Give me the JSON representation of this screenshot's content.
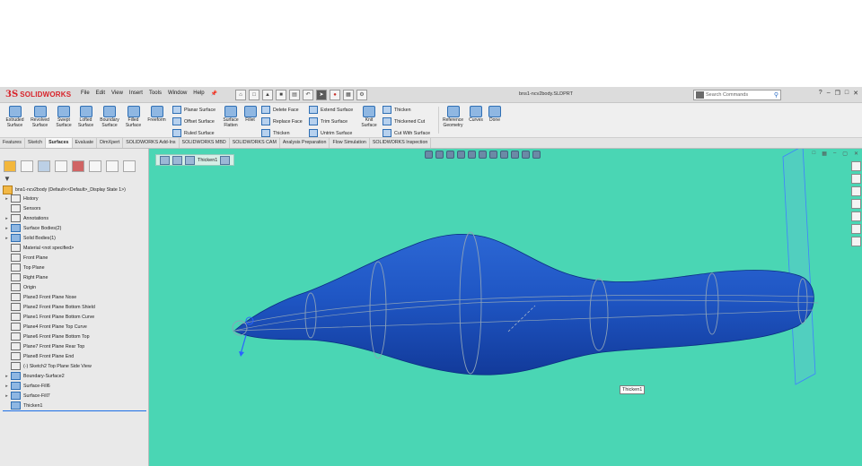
{
  "app": {
    "logo_ds": "3S",
    "logo_text": "SOLIDWORKS",
    "doc_title": "bns1-ncv2body.SLDPRT",
    "menus": [
      "File",
      "Edit",
      "View",
      "Insert",
      "Tools",
      "Window",
      "Help"
    ],
    "search_placeholder": "Search Commands",
    "help_label": "?"
  },
  "ribbon": {
    "large_buttons": [
      {
        "label": "Extruded Surface",
        "icon": "extruded-surface-icon"
      },
      {
        "label": "Revolved Surface",
        "icon": "revolved-surface-icon"
      },
      {
        "label": "Swept Surface",
        "icon": "swept-surface-icon"
      },
      {
        "label": "Lofted Surface",
        "icon": "lofted-surface-icon"
      },
      {
        "label": "Boundary Surface",
        "icon": "boundary-surface-icon"
      },
      {
        "label": "Filled Surface",
        "icon": "filled-surface-icon"
      },
      {
        "label": "Freeform",
        "icon": "freeform-icon"
      }
    ],
    "small_col1": [
      "Planar Surface",
      "Offset Surface",
      "Ruled Surface"
    ],
    "surface_flatten": "Surface Flatten",
    "fillet": "Fillet",
    "small_col2": [
      "Delete Face",
      "Replace Face",
      "Thicken"
    ],
    "small_col3": [
      "Extend Surface",
      "Trim Surface",
      "Untrim Surface"
    ],
    "knit_surface": "Knit Surface",
    "small_col4": [
      "Thicken",
      "Thickened Cut",
      "Cut With Surface"
    ],
    "reference_geometry": "Reference Geometry",
    "curves": "Curves",
    "done": "Done"
  },
  "tabs": [
    "Features",
    "Sketch",
    "Surfaces",
    "Evaluate",
    "DimXpert",
    "SOLIDWORKS Add-Ins",
    "SOLIDWORKS MBD",
    "SOLIDWORKS CAM",
    "Analysis Preparation",
    "Flow Simulation",
    "SOLIDWORKS Inspection"
  ],
  "active_tab": "Surfaces",
  "feature_tree": {
    "root": "bns1-ncv2body  (Default<<Default>_Display State 1>)",
    "items": [
      {
        "label": "History",
        "expand": true,
        "icon": "history-icon"
      },
      {
        "label": "Sensors",
        "expand": false,
        "icon": "sensors-icon"
      },
      {
        "label": "Annotations",
        "expand": true,
        "icon": "annotations-icon"
      },
      {
        "label": "Surface Bodies(2)",
        "expand": true,
        "icon": "surface-bodies-icon",
        "blue": true
      },
      {
        "label": "Solid Bodies(1)",
        "expand": true,
        "icon": "solid-bodies-icon",
        "blue": true
      },
      {
        "label": "Material <not specified>",
        "expand": false,
        "icon": "material-icon"
      },
      {
        "label": "Front Plane",
        "expand": false,
        "icon": "plane-icon"
      },
      {
        "label": "Top Plane",
        "expand": false,
        "icon": "plane-icon"
      },
      {
        "label": "Right Plane",
        "expand": false,
        "icon": "plane-icon"
      },
      {
        "label": "Origin",
        "expand": false,
        "icon": "origin-icon"
      },
      {
        "label": "Plane3 Front Plane Nose",
        "expand": false,
        "icon": "plane-icon"
      },
      {
        "label": "Plane2 Front Plane Bottom Shield",
        "expand": false,
        "icon": "plane-icon"
      },
      {
        "label": "Plane1 Front Plane Bottom Curve",
        "expand": false,
        "icon": "plane-icon"
      },
      {
        "label": "Plane4 Front Plane Top Curve",
        "expand": false,
        "icon": "plane-icon"
      },
      {
        "label": "Plane6 Front Plane Bottom Top",
        "expand": false,
        "icon": "plane-icon"
      },
      {
        "label": "Plane7 Front Plane Rear Top",
        "expand": false,
        "icon": "plane-icon"
      },
      {
        "label": "Plane8 Front Plane End",
        "expand": false,
        "icon": "plane-icon"
      },
      {
        "label": "(-) Sketch2 Top Plane Side View",
        "expand": false,
        "icon": "sketch-icon"
      },
      {
        "label": "Boundary-Surface2",
        "expand": true,
        "icon": "boundary-surface-icon",
        "blue": true
      },
      {
        "label": "Surface-Fill6",
        "expand": true,
        "icon": "surface-fill-icon",
        "blue": true
      },
      {
        "label": "Surface-Fill7",
        "expand": true,
        "icon": "surface-fill-icon",
        "blue": true
      },
      {
        "label": "Thicken1",
        "expand": false,
        "icon": "thicken-icon",
        "blue": true,
        "selected": true
      }
    ]
  },
  "viewport": {
    "breadcrumb": "Thicken1",
    "tooltip": "Thicken1",
    "background": "#4ad6b4",
    "body_color": "#1f56c4"
  }
}
